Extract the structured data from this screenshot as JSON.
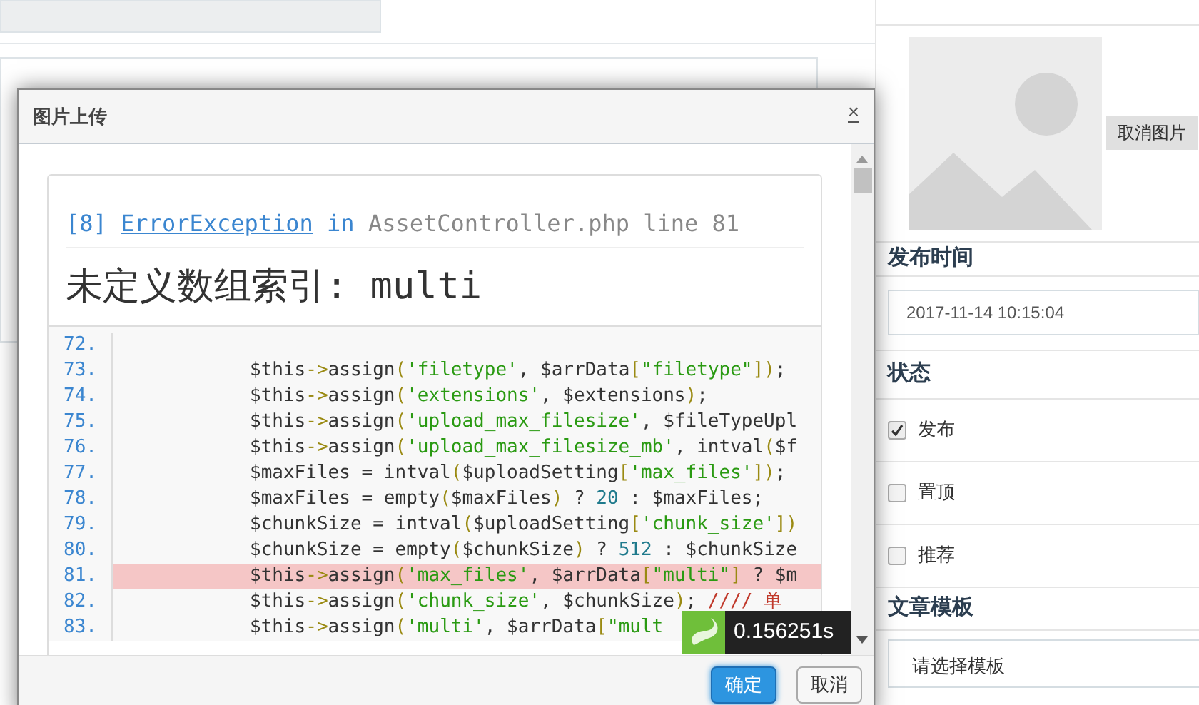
{
  "sidebar": {
    "thumbnail": {
      "cancel_button": "取消图片"
    },
    "publish_time": {
      "heading": "发布时间",
      "value": "2017-11-14 10:15:04"
    },
    "status": {
      "heading": "状态",
      "options": [
        {
          "label": "发布",
          "checked": true
        },
        {
          "label": "置顶",
          "checked": false
        },
        {
          "label": "推荐",
          "checked": false
        }
      ]
    },
    "template": {
      "heading": "文章模板",
      "value": "请选择模板"
    }
  },
  "dialog": {
    "title": "图片上传",
    "close": "×",
    "error": {
      "code": "[8]",
      "exception": "ErrorException",
      "in": "in",
      "file": "AssetController.php line 81",
      "message": "未定义数组索引: multi",
      "lines": [
        {
          "number": "72.",
          "highlighted": false
        },
        {
          "number": "73.",
          "code": "$this->assign('filetype', $arrData[\"filetype\"]);",
          "highlighted": false
        },
        {
          "number": "74.",
          "code": "$this->assign('extensions', $extensions);",
          "highlighted": false
        },
        {
          "number": "75.",
          "code": "$this->assign('upload_max_filesize', $fileTypeUpl",
          "highlighted": false
        },
        {
          "number": "76.",
          "code": "$this->assign('upload_max_filesize_mb', intval($f",
          "highlighted": false
        },
        {
          "number": "77.",
          "code": "$maxFiles  = intval($uploadSetting['max_files']);",
          "highlighted": false
        },
        {
          "number": "78.",
          "code": "$maxFiles  = empty($maxFiles) ? 20 : $maxFiles;",
          "highlighted": false
        },
        {
          "number": "79.",
          "code": "$chunkSize = intval($uploadSetting['chunk_size'])",
          "highlighted": false
        },
        {
          "number": "80.",
          "code": "$chunkSize = empty($chunkSize) ? 512 : $chunkSize",
          "highlighted": false
        },
        {
          "number": "81.",
          "code": "$this->assign('max_files', $arrData[\"multi\"] ? $m",
          "highlighted": true
        },
        {
          "number": "82.",
          "code": "$this->assign('chunk_size', $chunkSize); //// 单",
          "highlighted": false
        },
        {
          "number": "83.",
          "code": "$this->assign('multi', $arrData[\"mult",
          "highlighted": false
        }
      ]
    },
    "debug_badge": {
      "time": "0.156251s"
    },
    "buttons": [
      {
        "label": "确定",
        "kind": "primary"
      },
      {
        "label": "取消",
        "kind": "default"
      }
    ]
  }
}
